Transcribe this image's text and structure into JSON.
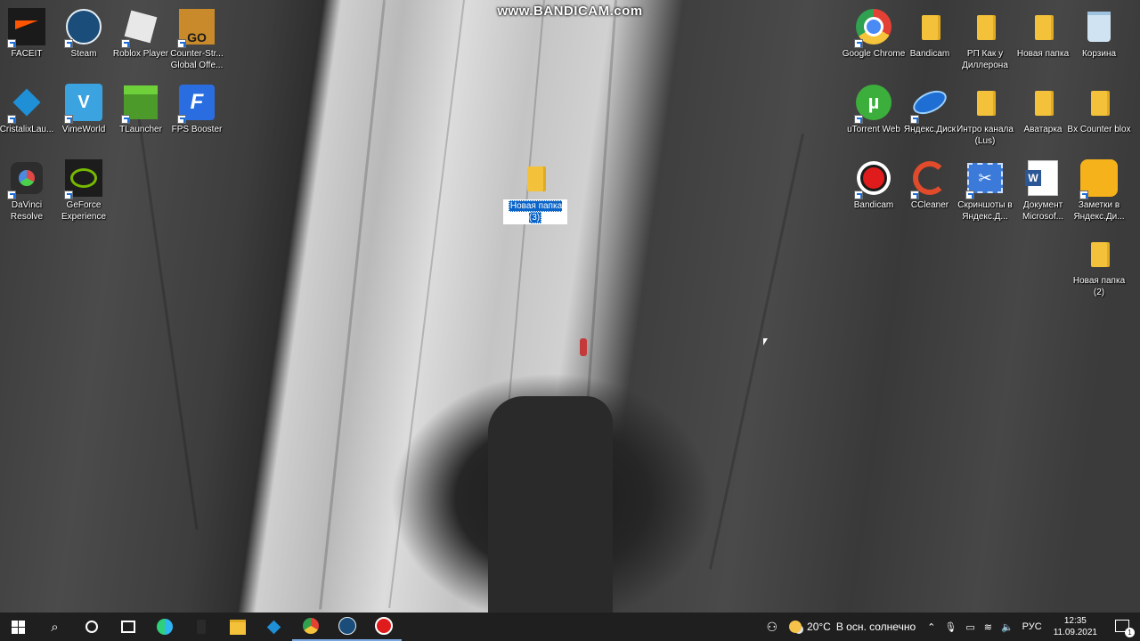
{
  "watermark": "www.BANDICAM.com",
  "desktop_icons": [
    {
      "label": "FACEIT",
      "icon": "faceit-icon",
      "color": "#1a1a1a"
    },
    {
      "label": "Steam",
      "icon": "steam-icon",
      "color": "#1b4d7a"
    },
    {
      "label": "Roblox Player",
      "icon": "roblox-icon",
      "color": "#e8e8e8"
    },
    {
      "label": "Counter-Str... Global Offe...",
      "icon": "csgo-icon",
      "color": "#c88a2a"
    },
    {
      "label": "CristalixLau...",
      "icon": "cristalix-icon",
      "color": "#1f8fd6"
    },
    {
      "label": "VimeWorld",
      "icon": "vimeworld-icon",
      "color": "#3aa3e0"
    },
    {
      "label": "TLauncher",
      "icon": "tlauncher-icon",
      "color": "#4c9a2a"
    },
    {
      "label": "FPS Booster",
      "icon": "fps-booster-icon",
      "color": "#2a6de0"
    },
    {
      "label": "DaVinci Resolve",
      "icon": "davinci-icon",
      "color": "#2d2d2d"
    },
    {
      "label": "GeForce Experience",
      "icon": "geforce-icon",
      "color": "#76b900"
    },
    {
      "label": "Google Chrome",
      "icon": "chrome-icon",
      "color": "#e44134"
    },
    {
      "label": "Bandicam",
      "icon": "folder-icon",
      "color": "#f3c23a"
    },
    {
      "label": "РП Как у Диллерона",
      "icon": "folder-icon",
      "color": "#f3c23a"
    },
    {
      "label": "Новая папка",
      "icon": "folder-icon",
      "color": "#f3c23a"
    },
    {
      "label": "Корзина",
      "icon": "recycle-bin-icon",
      "color": "#cfe3f2"
    },
    {
      "label": "uTorrent Web",
      "icon": "utorrent-icon",
      "color": "#3cae3c"
    },
    {
      "label": "Яндекс.Диск",
      "icon": "yandex-disk-icon",
      "color": "#1f6ed4"
    },
    {
      "label": "Интро канала (Lus)",
      "icon": "folder-icon",
      "color": "#f3c23a"
    },
    {
      "label": "Аватарка",
      "icon": "folder-icon",
      "color": "#f3c23a"
    },
    {
      "label": "Bx Counter blox",
      "icon": "folder-icon",
      "color": "#f3c23a"
    },
    {
      "label": "Bandicam",
      "icon": "bandicam-icon",
      "color": "#e01b1b"
    },
    {
      "label": "CCleaner",
      "icon": "ccleaner-icon",
      "color": "#e14b2b"
    },
    {
      "label": "Скриншоты в Яндекс.Д...",
      "icon": "yandex-screenshots-icon",
      "color": "#3b7ad8"
    },
    {
      "label": "Документ Microsof...",
      "icon": "word-document-icon",
      "color": "#2b5797"
    },
    {
      "label": "Заметки в Яндекс.Ди...",
      "icon": "yandex-notes-icon",
      "color": "#f6b21a"
    },
    {
      "label": "Новая папка (2)",
      "icon": "folder-icon",
      "color": "#f3c23a"
    }
  ],
  "selected_folder": {
    "label_line1": "Новая папка",
    "label_line2": "(3)"
  },
  "taskbar": {
    "start": "windows-start-icon",
    "apps": [
      "search-icon",
      "cortana-icon",
      "task-view-icon",
      "edge-icon",
      "blank-app-icon",
      "file-explorer-icon",
      "cristalix-taskbar-icon",
      "chrome-taskbar-icon",
      "steam-taskbar-icon",
      "bandicam-taskbar-icon"
    ]
  },
  "tray": {
    "weather_temp": "20°C",
    "weather_text": "В осн. солнечно",
    "language": "РУС",
    "time": "12:35",
    "date": "11.09.2021",
    "notification_count": "1"
  }
}
